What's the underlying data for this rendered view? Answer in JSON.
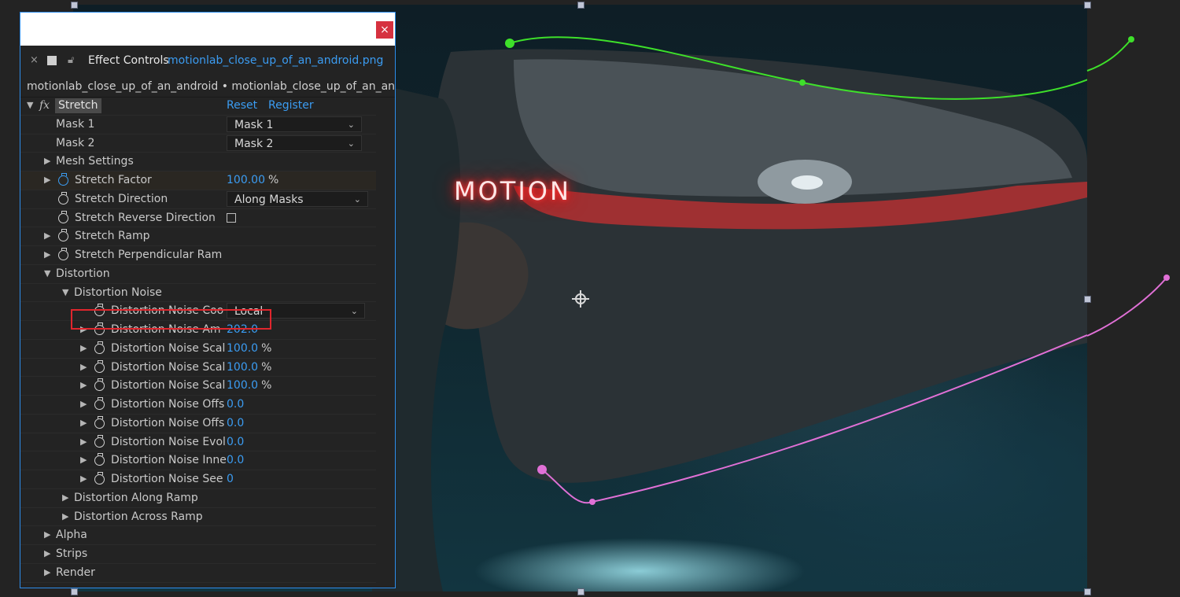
{
  "panel": {
    "tab_title": "Effect Controls",
    "tab_layer": "motionlab_close_up_of_an_android.png",
    "breadcrumb": "motionlab_close_up_of_an_android • motionlab_close_up_of_an_android.png",
    "close_label": "×",
    "tab_close_label": "×"
  },
  "effect": {
    "badge": "fx",
    "name": "Stretch",
    "reset_label": "Reset",
    "register_label": "Register"
  },
  "params": {
    "mask1": {
      "label": "Mask 1",
      "value": "Mask 1"
    },
    "mask2": {
      "label": "Mask 2",
      "value": "Mask 2"
    },
    "mesh_settings": {
      "label": "Mesh Settings"
    },
    "stretch_factor": {
      "label": "Stretch Factor",
      "value": "100.00",
      "unit": "%"
    },
    "stretch_direction": {
      "label": "Stretch Direction",
      "value": "Along Masks"
    },
    "stretch_reverse": {
      "label": "Stretch Reverse Direction",
      "checked": false
    },
    "stretch_ramp": {
      "label": "Stretch Ramp"
    },
    "stretch_perp": {
      "label": "Stretch Perpendicular Ram"
    },
    "distortion": {
      "label": "Distortion"
    },
    "distortion_noise": {
      "label": "Distortion Noise"
    },
    "dn_coord": {
      "label": "Distortion Noise Coo",
      "value": "Local"
    },
    "dn_amount": {
      "label": "Distortion Noise Am",
      "value": "202.0"
    },
    "dn_scale1": {
      "label": "Distortion Noise Scal",
      "value": "100.0",
      "unit": "%"
    },
    "dn_scale2": {
      "label": "Distortion Noise Scal",
      "value": "100.0",
      "unit": "%"
    },
    "dn_scale3": {
      "label": "Distortion Noise Scal",
      "value": "100.0",
      "unit": "%"
    },
    "dn_offset1": {
      "label": "Distortion Noise Offs",
      "value": "0.0"
    },
    "dn_offset2": {
      "label": "Distortion Noise Offs",
      "value": "0.0"
    },
    "dn_evol": {
      "label": "Distortion Noise Evol",
      "value": "0.0"
    },
    "dn_inner": {
      "label": "Distortion Noise Inne",
      "value": "0.0"
    },
    "dn_seed": {
      "label": "Distortion Noise See",
      "value": "0"
    },
    "dist_along": {
      "label": "Distortion Along Ramp"
    },
    "dist_across": {
      "label": "Distortion Across Ramp"
    },
    "alpha": {
      "label": "Alpha"
    },
    "strips": {
      "label": "Strips"
    },
    "render": {
      "label": "Render"
    }
  },
  "viewer": {
    "overlay_text": "MOTION",
    "mask1_color": "#3ee02a",
    "mask2_color": "#e070d6",
    "highlight_color": "#e0262d",
    "accent_color": "#3b9cf2"
  }
}
